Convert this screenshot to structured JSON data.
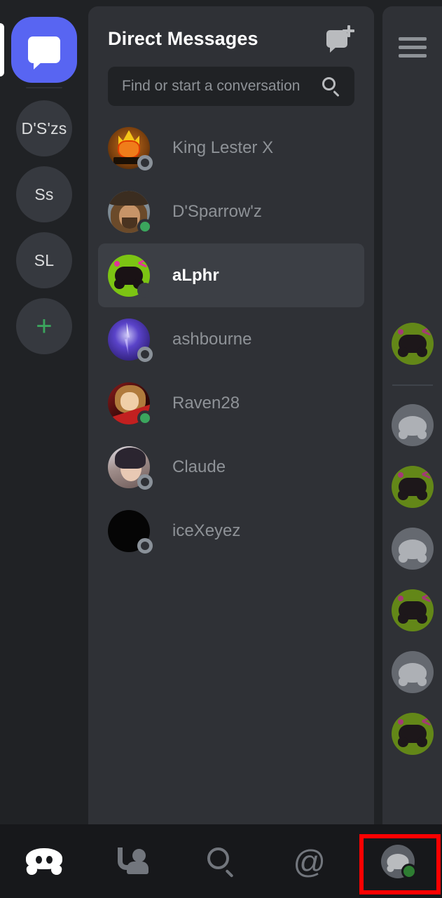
{
  "app": {
    "name": "Discord"
  },
  "server_rail": {
    "home": {
      "name": "Direct Messages",
      "icon": "dm-bubble-icon",
      "active": true,
      "color": "#5865F2"
    },
    "servers": [
      {
        "label": "D'S'zs"
      },
      {
        "label": "Ss"
      },
      {
        "label": "SL"
      }
    ],
    "add_server": {
      "label": "+"
    }
  },
  "dm_panel": {
    "title": "Direct Messages",
    "new_dm_icon": "new-message-icon",
    "search": {
      "placeholder": "Find or start a conversation",
      "value": "",
      "icon": "search-icon"
    },
    "conversations": [
      {
        "name": "King Lester X",
        "status": "offline",
        "avatar": "lester",
        "selected": false
      },
      {
        "name": "D'Sparrow'z",
        "status": "online",
        "avatar": "sparrow",
        "selected": false
      },
      {
        "name": "aLphr",
        "status": "offline",
        "avatar": "green-controller",
        "selected": true
      },
      {
        "name": "ashbourne",
        "status": "offline",
        "avatar": "ashbourne",
        "selected": false
      },
      {
        "name": "Raven28",
        "status": "online",
        "avatar": "raven",
        "selected": false
      },
      {
        "name": "Claude",
        "status": "offline",
        "avatar": "claude",
        "selected": false
      },
      {
        "name": "iceXeyez",
        "status": "offline",
        "avatar": "black",
        "selected": false
      }
    ]
  },
  "right_panel": {
    "menu_icon": "hamburger-menu-icon",
    "members": [
      {
        "avatar": "green-controller"
      },
      {
        "avatar": "discord-default"
      },
      {
        "avatar": "green-controller"
      },
      {
        "avatar": "discord-default"
      },
      {
        "avatar": "green-controller"
      },
      {
        "avatar": "discord-default"
      },
      {
        "avatar": "green-controller"
      }
    ]
  },
  "bottom_nav": {
    "items": [
      {
        "name": "servers",
        "icon": "discord-logo-icon",
        "active": true
      },
      {
        "name": "friends",
        "icon": "friends-icon",
        "active": false
      },
      {
        "name": "search",
        "icon": "search-icon",
        "active": false
      },
      {
        "name": "mentions",
        "icon": "at-icon",
        "glyph": "@",
        "active": false
      },
      {
        "name": "profile",
        "icon": "profile-avatar-icon",
        "active": false,
        "status": "online"
      }
    ],
    "highlight": {
      "target": "profile",
      "color": "#ff0000"
    }
  },
  "colors": {
    "blurple": "#5865F2",
    "online_green": "#3ba55d",
    "accent_green": "#7CC413",
    "panel_bg": "#2f3136",
    "rail_bg": "#202225",
    "nav_bg": "#17181b",
    "selected_row": "#3c3f45",
    "highlight_red": "#ff0000"
  }
}
